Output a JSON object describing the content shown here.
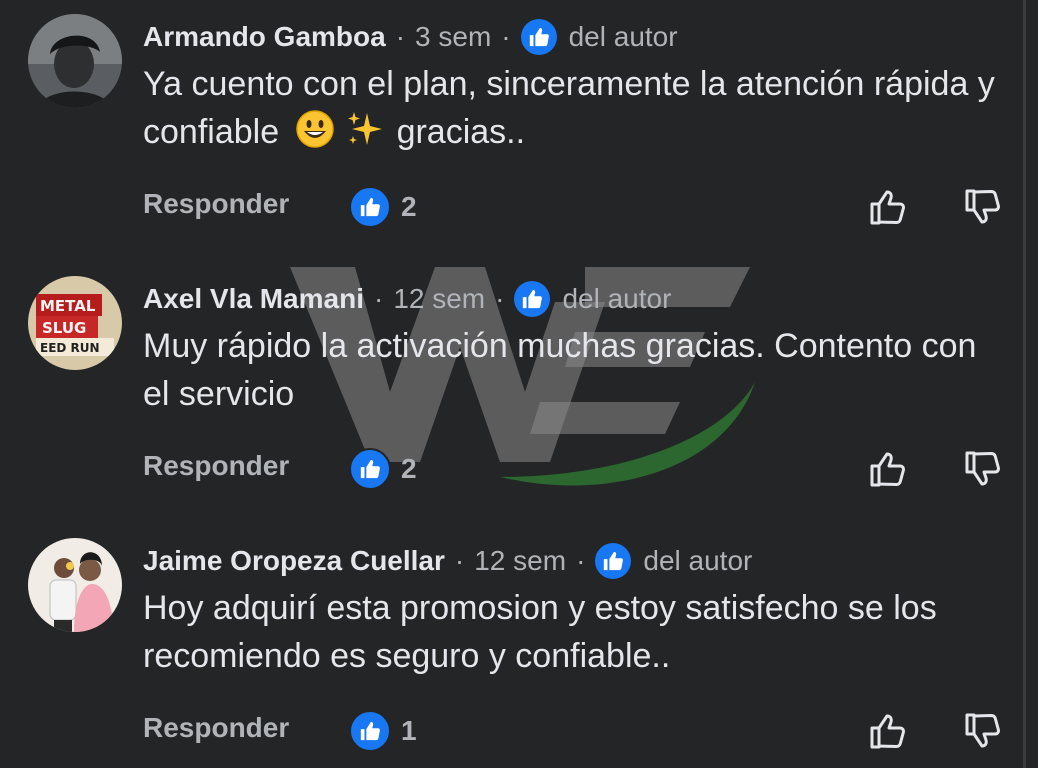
{
  "comments": [
    {
      "author": "Armando Gamboa",
      "time": "3 sem",
      "author_tag": "del autor",
      "text_before": "Ya cuento con el plan, sinceramente la atención rápida y confiable",
      "text_after": "gracias..",
      "reply_label": "Responder",
      "like_count": "2"
    },
    {
      "author": "Axel Vla Mamani",
      "time": "12 sem",
      "author_tag": "del autor",
      "text": "Muy rápido la activación muchas gracias. Contento con el servicio",
      "reply_label": "Responder",
      "like_count": "2",
      "avatar_text": [
        "METAL",
        "SLUG",
        "EED RUN"
      ]
    },
    {
      "author": "Jaime Oropeza Cuellar",
      "time": "12 sem",
      "author_tag": "del autor",
      "text": "Hoy adquirí esta promosion y estoy satisfecho se los recomiendo es seguro y confiable..",
      "reply_label": "Responder",
      "like_count": "1"
    }
  ],
  "separator": "·",
  "colors": {
    "background": "#242526",
    "accent": "#1877f2",
    "text_primary": "#e4e6eb",
    "text_secondary": "#b0b3b8"
  },
  "icons": {
    "badge": "thumbs-up-icon",
    "reaction": "thumbs-up-icon",
    "like_action": "thumbs-up-outline-icon",
    "dislike_action": "thumbs-down-outline-icon"
  }
}
